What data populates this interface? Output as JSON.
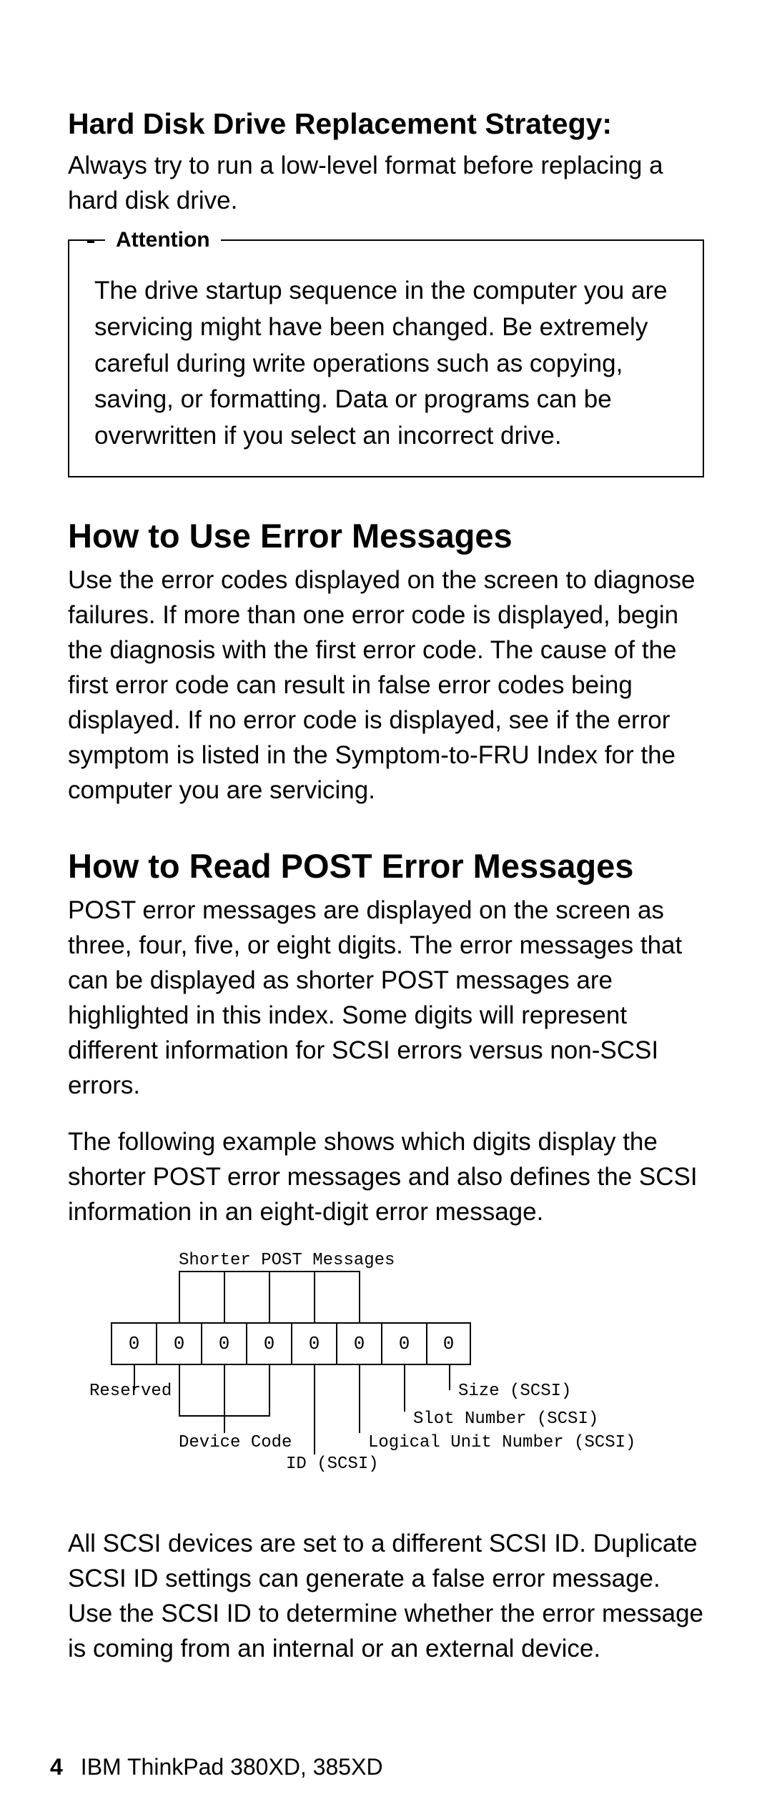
{
  "sections": {
    "hdd": {
      "title": "Hard Disk Drive Replacement Strategy:",
      "p1": "Always try to run a low-level format before replacing a hard disk drive."
    },
    "attention": {
      "legend": "Attention",
      "body": "The drive startup sequence in the computer you are servicing might have been changed.  Be extremely careful during write operations such as copying, saving, or formatting.  Data or programs can be overwritten if you select an incorrect drive."
    },
    "use_err": {
      "title": "How to Use Error Messages",
      "p1": "Use the error codes displayed on the screen to diagnose failures.  If more than one error code is displayed, begin the diagnosis with the first error code.  The cause of the first error code can result in false error codes being displayed.  If no error code is displayed, see if the error symptom is listed in the Symptom-to-FRU Index for the computer you are servicing."
    },
    "read_post": {
      "title": "How to Read POST Error Messages",
      "p1": "POST error messages are displayed on the screen as three, four, five, or eight digits.  The error messages that can be displayed as shorter POST messages are highlighted in this index.  Some digits will represent different information for SCSI errors versus non-SCSI errors.",
      "p2": "The following example shows which digits display the shorter POST error messages and also defines the SCSI information in an eight-digit error message.",
      "p3": "All SCSI devices are set to a different SCSI ID.  Duplicate SCSI ID settings can generate a false error message.  Use the SCSI ID to determine whether the error message is coming from an internal or an external device."
    }
  },
  "diagram": {
    "top_label": "Shorter POST Messages",
    "digits": [
      "0",
      "0",
      "0",
      "0",
      "0",
      "0",
      "0",
      "0"
    ],
    "labels": {
      "reserved": "Reserved",
      "device_code": "Device Code",
      "id_scsi": "ID (SCSI)",
      "lun": "Logical Unit Number (SCSI)",
      "slot": "Slot Number (SCSI)",
      "size": "Size (SCSI)"
    }
  },
  "footer": {
    "page": "4",
    "book": "IBM ThinkPad 380XD, 385XD"
  }
}
